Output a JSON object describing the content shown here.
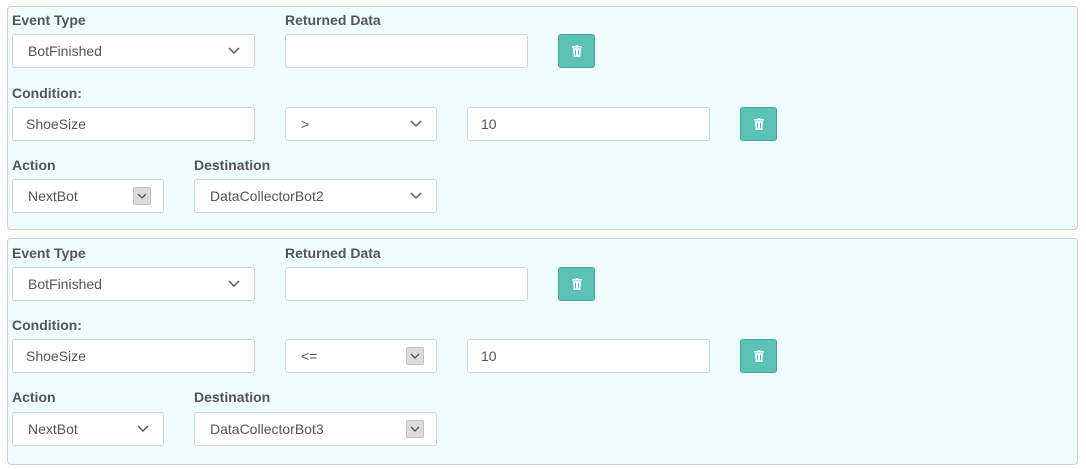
{
  "rules": [
    {
      "event_type_label": "Event Type",
      "event_type_value": "BotFinished",
      "returned_data_label": "Returned Data",
      "returned_data_value": "",
      "condition_label": "Condition:",
      "condition_field": "ShoeSize",
      "condition_operator": ">",
      "condition_value": "10",
      "action_label": "Action",
      "action_value": "NextBot",
      "destination_label": "Destination",
      "destination_value": "DataCollectorBot2"
    },
    {
      "event_type_label": "Event Type",
      "event_type_value": "BotFinished",
      "returned_data_label": "Returned Data",
      "returned_data_value": "",
      "condition_label": "Condition:",
      "condition_field": "ShoeSize",
      "condition_operator": "<=",
      "condition_value": "10",
      "action_label": "Action",
      "action_value": "NextBot",
      "destination_label": "Destination",
      "destination_value": "DataCollectorBot3"
    }
  ],
  "colors": {
    "panel_background": "#f0fdfe",
    "delete_button": "#5ac3b6",
    "label_text": "#555555"
  },
  "icons": {
    "delete": "trash-icon",
    "dropdown": "chevron-down-icon"
  }
}
